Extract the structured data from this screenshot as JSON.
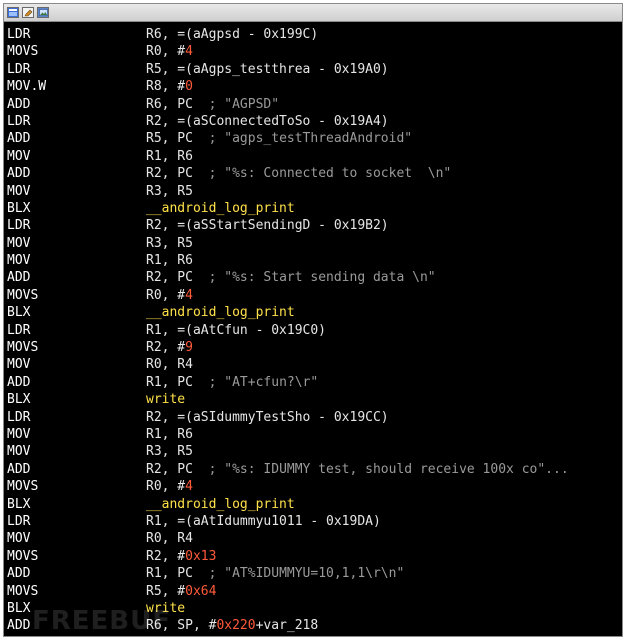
{
  "window": {
    "titlebar_icons": [
      "window-icon",
      "edit-icon",
      "image-icon"
    ]
  },
  "listing": [
    {
      "mnemonic": "LDR",
      "ops": [
        {
          "t": "R6, =(aAgpsd - 0x199C)",
          "c": "op"
        }
      ]
    },
    {
      "mnemonic": "MOVS",
      "ops": [
        {
          "t": "R0, #",
          "c": "op"
        },
        {
          "t": "4",
          "c": "num"
        }
      ]
    },
    {
      "mnemonic": "LDR",
      "ops": [
        {
          "t": "R5, =(aAgps_testthrea - 0x19A0)",
          "c": "op"
        }
      ]
    },
    {
      "mnemonic": "MOV.W",
      "ops": [
        {
          "t": "R8, #",
          "c": "op"
        },
        {
          "t": "0",
          "c": "num"
        }
      ]
    },
    {
      "mnemonic": "ADD",
      "ops": [
        {
          "t": "R6, PC  ",
          "c": "op"
        },
        {
          "t": "; \"AGPSD\"",
          "c": "cm"
        }
      ]
    },
    {
      "mnemonic": "LDR",
      "ops": [
        {
          "t": "R2, =(aSConnectedToSo - 0x19A4)",
          "c": "op"
        }
      ]
    },
    {
      "mnemonic": "ADD",
      "ops": [
        {
          "t": "R5, PC  ",
          "c": "op"
        },
        {
          "t": "; \"agps_testThreadAndroid\"",
          "c": "cm"
        }
      ]
    },
    {
      "mnemonic": "MOV",
      "ops": [
        {
          "t": "R1, R6",
          "c": "op"
        }
      ]
    },
    {
      "mnemonic": "ADD",
      "ops": [
        {
          "t": "R2, PC  ",
          "c": "op"
        },
        {
          "t": "; \"%s: Connected to socket  \\n\"",
          "c": "cm"
        }
      ]
    },
    {
      "mnemonic": "MOV",
      "ops": [
        {
          "t": "R3, R5",
          "c": "op"
        }
      ]
    },
    {
      "mnemonic": "BLX",
      "ops": [
        {
          "t": "__android_log_print",
          "c": "fn"
        }
      ]
    },
    {
      "mnemonic": "LDR",
      "ops": [
        {
          "t": "R2, =(aSStartSendingD - 0x19B2)",
          "c": "op"
        }
      ]
    },
    {
      "mnemonic": "MOV",
      "ops": [
        {
          "t": "R3, R5",
          "c": "op"
        }
      ]
    },
    {
      "mnemonic": "MOV",
      "ops": [
        {
          "t": "R1, R6",
          "c": "op"
        }
      ]
    },
    {
      "mnemonic": "ADD",
      "ops": [
        {
          "t": "R2, PC  ",
          "c": "op"
        },
        {
          "t": "; \"%s: Start sending data \\n\"",
          "c": "cm"
        }
      ]
    },
    {
      "mnemonic": "MOVS",
      "ops": [
        {
          "t": "R0, #",
          "c": "op"
        },
        {
          "t": "4",
          "c": "num"
        }
      ]
    },
    {
      "mnemonic": "BLX",
      "ops": [
        {
          "t": "__android_log_print",
          "c": "fn"
        }
      ]
    },
    {
      "mnemonic": "LDR",
      "ops": [
        {
          "t": "R1, =(aAtCfun - 0x19C0)",
          "c": "op"
        }
      ]
    },
    {
      "mnemonic": "MOVS",
      "ops": [
        {
          "t": "R2, #",
          "c": "op"
        },
        {
          "t": "9",
          "c": "num"
        }
      ]
    },
    {
      "mnemonic": "MOV",
      "ops": [
        {
          "t": "R0, R4",
          "c": "op"
        }
      ]
    },
    {
      "mnemonic": "ADD",
      "ops": [
        {
          "t": "R1, PC  ",
          "c": "op"
        },
        {
          "t": "; \"AT+cfun?\\r\"",
          "c": "cm"
        }
      ]
    },
    {
      "mnemonic": "BLX",
      "ops": [
        {
          "t": "write",
          "c": "fn"
        }
      ]
    },
    {
      "mnemonic": "LDR",
      "ops": [
        {
          "t": "R2, =(aSIdummyTestSho - 0x19CC)",
          "c": "op"
        }
      ]
    },
    {
      "mnemonic": "MOV",
      "ops": [
        {
          "t": "R1, R6",
          "c": "op"
        }
      ]
    },
    {
      "mnemonic": "MOV",
      "ops": [
        {
          "t": "R3, R5",
          "c": "op"
        }
      ]
    },
    {
      "mnemonic": "ADD",
      "ops": [
        {
          "t": "R2, PC  ",
          "c": "op"
        },
        {
          "t": "; \"%s: IDUMMY test, should receive 100x co\"...",
          "c": "cm"
        }
      ]
    },
    {
      "mnemonic": "MOVS",
      "ops": [
        {
          "t": "R0, #",
          "c": "op"
        },
        {
          "t": "4",
          "c": "num"
        }
      ]
    },
    {
      "mnemonic": "BLX",
      "ops": [
        {
          "t": "__android_log_print",
          "c": "fn"
        }
      ]
    },
    {
      "mnemonic": "LDR",
      "ops": [
        {
          "t": "R1, =(aAtIdummyu1011 - 0x19DA)",
          "c": "op"
        }
      ]
    },
    {
      "mnemonic": "MOV",
      "ops": [
        {
          "t": "R0, R4",
          "c": "op"
        }
      ]
    },
    {
      "mnemonic": "MOVS",
      "ops": [
        {
          "t": "R2, #",
          "c": "op"
        },
        {
          "t": "0x13",
          "c": "num"
        }
      ]
    },
    {
      "mnemonic": "ADD",
      "ops": [
        {
          "t": "R1, PC  ",
          "c": "op"
        },
        {
          "t": "; \"AT%IDUMMYU=10,1,1\\r\\n\"",
          "c": "cm"
        }
      ]
    },
    {
      "mnemonic": "MOVS",
      "ops": [
        {
          "t": "R5, #",
          "c": "op"
        },
        {
          "t": "0x64",
          "c": "num"
        }
      ]
    },
    {
      "mnemonic": "BLX",
      "ops": [
        {
          "t": "write",
          "c": "fn"
        }
      ]
    },
    {
      "mnemonic": "ADD",
      "ops": [
        {
          "t": "R6, SP, #",
          "c": "op"
        },
        {
          "t": "0x220",
          "c": "num"
        },
        {
          "t": "+var_218",
          "c": "lb"
        }
      ]
    }
  ]
}
